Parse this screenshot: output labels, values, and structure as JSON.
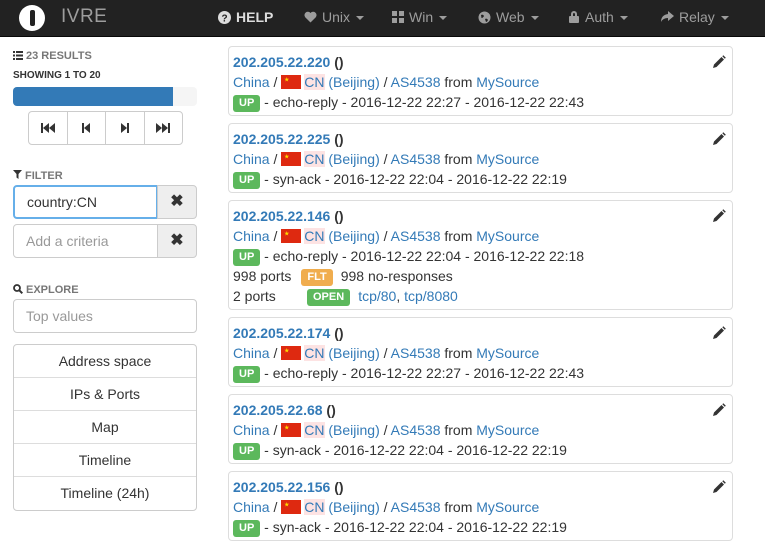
{
  "navbar": {
    "brand": "IVRE",
    "items": [
      {
        "label": "HELP",
        "icon": "question-circle-icon"
      },
      {
        "label": "Unix",
        "icon": "heart-icon"
      },
      {
        "label": "Win",
        "icon": "windows-grid-icon"
      },
      {
        "label": "Web",
        "icon": "globe-icon"
      },
      {
        "label": "Auth",
        "icon": "lock-icon"
      },
      {
        "label": "Relay",
        "icon": "share-arrow-icon"
      }
    ]
  },
  "sidebar": {
    "results_count": "23 RESULTS",
    "showing": "SHOWING 1 TO 20",
    "progress_fraction": 0.87,
    "pager": [
      "first-page",
      "previous-page",
      "next-page",
      "last-page"
    ],
    "filter_title": "FILTER",
    "filter_value": "country:CN",
    "criteria_placeholder": "Add a criteria",
    "remove_label": "✖",
    "explore_title": "EXPLORE",
    "topvalues_placeholder": "Top values",
    "explore_links": [
      "Address space",
      "IPs & Ports",
      "Map",
      "Timeline",
      "Timeline (24h)"
    ]
  },
  "results": [
    {
      "ip": "202.205.22.220",
      "hostname": "()",
      "country": "China",
      "cc": "CN",
      "city": "(Beijing)",
      "as": "AS4538",
      "from": "from",
      "source": "MySource",
      "state": "UP",
      "reason": "- echo-reply - 2016-12-22 22:27 - 2016-12-22 22:43"
    },
    {
      "ip": "202.205.22.225",
      "hostname": "()",
      "country": "China",
      "cc": "CN",
      "city": "(Beijing)",
      "as": "AS4538",
      "from": "from",
      "source": "MySource",
      "state": "UP",
      "reason": "- syn-ack - 2016-12-22 22:04 - 2016-12-22 22:19"
    },
    {
      "ip": "202.205.22.146",
      "hostname": "()",
      "country": "China",
      "cc": "CN",
      "city": "(Beijing)",
      "as": "AS4538",
      "from": "from",
      "source": "MySource",
      "state": "UP",
      "reason": "- echo-reply - 2016-12-22 22:04 - 2016-12-22 22:18",
      "ports": [
        {
          "count": "998 ports",
          "state": "FLT",
          "detail": "998 no-responses"
        },
        {
          "count": "2 ports",
          "state": "OPEN",
          "links": [
            "tcp/80",
            "tcp/8080"
          ],
          "sep": ", "
        }
      ]
    },
    {
      "ip": "202.205.22.174",
      "hostname": "()",
      "country": "China",
      "cc": "CN",
      "city": "(Beijing)",
      "as": "AS4538",
      "from": "from",
      "source": "MySource",
      "state": "UP",
      "reason": "- echo-reply - 2016-12-22 22:27 - 2016-12-22 22:43"
    },
    {
      "ip": "202.205.22.68",
      "hostname": "()",
      "country": "China",
      "cc": "CN",
      "city": "(Beijing)",
      "as": "AS4538",
      "from": "from",
      "source": "MySource",
      "state": "UP",
      "reason": "- syn-ack - 2016-12-22 22:04 - 2016-12-22 22:19"
    },
    {
      "ip": "202.205.22.156",
      "hostname": "()",
      "country": "China",
      "cc": "CN",
      "city": "(Beijing)",
      "as": "AS4538",
      "from": "from",
      "source": "MySource",
      "state": "UP",
      "reason": "- syn-ack - 2016-12-22 22:04 - 2016-12-22 22:19"
    }
  ],
  "colors": {
    "navbar": "#222222",
    "link": "#337ab7",
    "label_up": "#5cb85c",
    "label_flt": "#f0ad4e",
    "progress": "#337ab7"
  }
}
